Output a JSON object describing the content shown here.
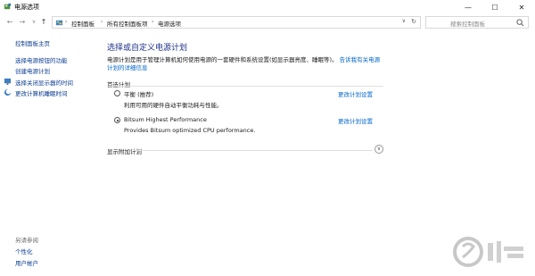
{
  "window": {
    "title": "电源选项",
    "minimize": "—",
    "maximize": "☐",
    "close": "✕"
  },
  "nav": {
    "back": "←",
    "forward": "→",
    "recent": "∨",
    "up": "↑"
  },
  "breadcrumb": {
    "items": [
      "控制面板",
      "所有控制面板项",
      "电源选项"
    ],
    "separator": "›",
    "lead_separator": "›",
    "dropdown": "∨",
    "refresh": "↻"
  },
  "search": {
    "placeholder": "搜索控制面板"
  },
  "sidebar": {
    "home": "控制面板主页",
    "links": [
      "选择电源按钮的功能",
      "创建电源计划"
    ],
    "icon_links": [
      "选择关闭显示器的时间",
      "更改计算机睡眠时间"
    ],
    "see_also_title": "另请参阅",
    "see_also": [
      "个性化",
      "用户帐户"
    ]
  },
  "main": {
    "title": "选择或自定义电源计划",
    "description": "电源计划是用于管理计算机如何使用电源的一套硬件和系统设置(如显示器亮度、睡眠等)。",
    "description_link": "告诉我有关电源计划的详细信息",
    "preferred_label": "首选计划",
    "plans": [
      {
        "name": "平衡 (推荐)",
        "description": "利用可用的硬件自动平衡功耗与性能。",
        "change_label": "更改计划设置",
        "selected": false
      },
      {
        "name": "Bitsum Highest Performance",
        "description": "Provides Bitsum optimized CPU performance.",
        "change_label": "更改计划设置",
        "selected": true
      }
    ],
    "extra_label": "显示附加计划",
    "extra_chevron": "∨"
  },
  "colors": {
    "link": "#0066cc",
    "title": "#1e3287",
    "sidebar_link": "#0b3d91"
  }
}
